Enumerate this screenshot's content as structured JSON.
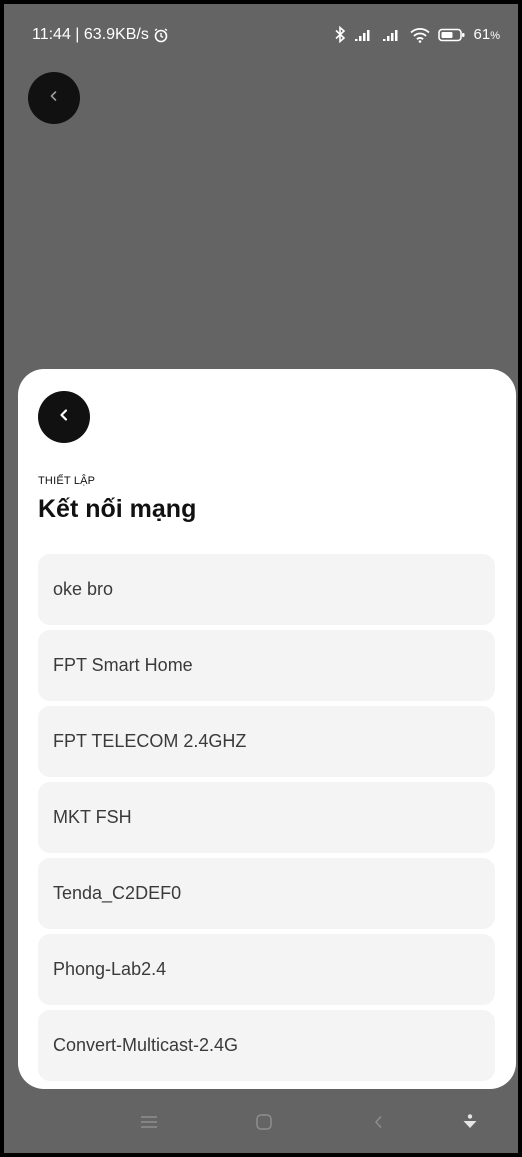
{
  "status_bar": {
    "time_speed": "11:44 | 63.9KB/s",
    "battery": "61",
    "battery_unit": "%",
    "icons": [
      "alarm-icon",
      "bluetooth-icon",
      "signal-icon",
      "signal-icon",
      "wifi-icon",
      "battery-icon"
    ]
  },
  "sheet": {
    "eyebrow": "THIẾT LẬP",
    "title": "Kết nối mạng",
    "networks": [
      {
        "label": "oke bro"
      },
      {
        "label": "FPT Smart Home"
      },
      {
        "label": "FPT TELECOM 2.4GHZ"
      },
      {
        "label": "MKT FSH"
      },
      {
        "label": "Tenda_C2DEF0"
      },
      {
        "label": "Phong-Lab2.4"
      },
      {
        "label": "Convert-Multicast-2.4G"
      }
    ]
  },
  "navbar": {
    "icons": [
      "menu-icon",
      "home-icon",
      "back-icon",
      "accessibility-icon"
    ]
  },
  "colors": {
    "overlay": "#646464",
    "sheet": "#ffffff",
    "item_bg": "#f4f4f4",
    "button_dark": "#111111"
  }
}
